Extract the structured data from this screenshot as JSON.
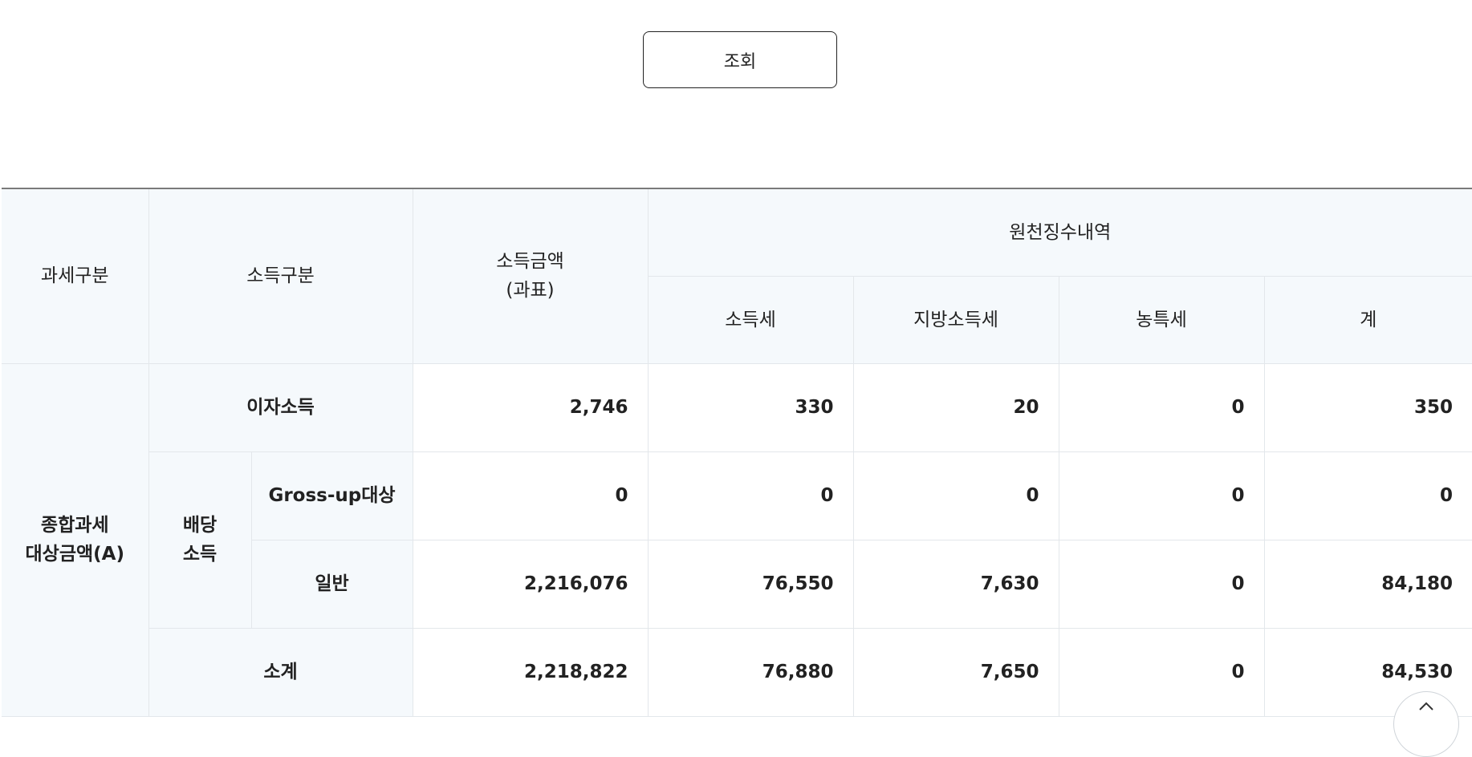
{
  "query": {
    "button_label": "조회"
  },
  "table": {
    "headers": {
      "tax_type": "과세구분",
      "income_type": "소득구분",
      "income_amount_line1": "소득금액",
      "income_amount_line2": "(과표)",
      "withholding_group": "원천징수내역",
      "income_tax": "소득세",
      "local_income_tax": "지방소득세",
      "rural_special_tax": "농특세",
      "total": "계"
    },
    "group_label_line1": "종합과세",
    "group_label_line2": "대상금액(A)",
    "dividend_label_line1": "배당",
    "dividend_label_line2": "소득",
    "rows": [
      {
        "label": "이자소득",
        "income_amount": "2,746",
        "income_tax": "330",
        "local_income_tax": "20",
        "rural_special_tax": "0",
        "total": "350"
      },
      {
        "label": "Gross-up대상",
        "income_amount": "0",
        "income_tax": "0",
        "local_income_tax": "0",
        "rural_special_tax": "0",
        "total": "0"
      },
      {
        "label": "일반",
        "income_amount": "2,216,076",
        "income_tax": "76,550",
        "local_income_tax": "7,630",
        "rural_special_tax": "0",
        "total": "84,180"
      },
      {
        "label": "소계",
        "income_amount": "2,218,822",
        "income_tax": "76,880",
        "local_income_tax": "7,650",
        "rural_special_tax": "0",
        "total": "84,530"
      }
    ]
  },
  "scroll_top": {
    "icon": "arrow-up-icon"
  }
}
